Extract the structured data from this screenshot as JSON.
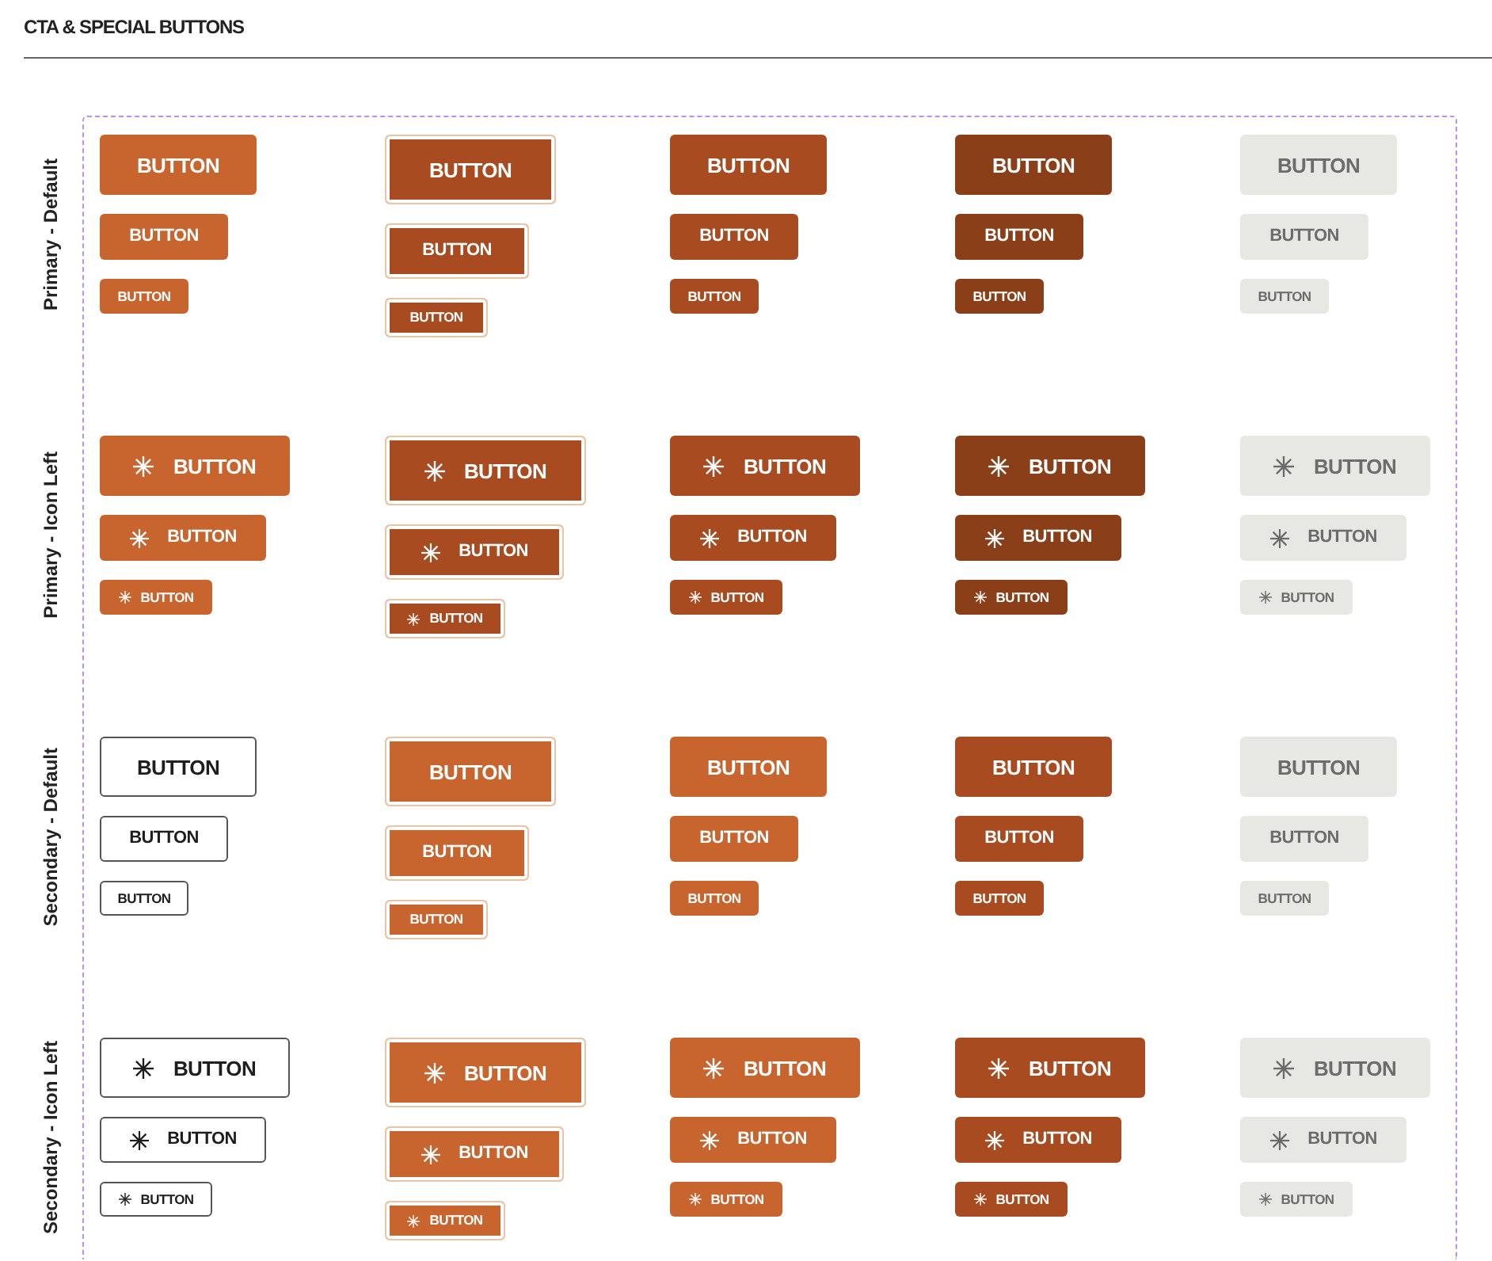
{
  "title": "CTA & SPECIAL BUTTONS",
  "groups": [
    {
      "label": "Primary - Default",
      "kind": "primary",
      "icon": false,
      "columns": [
        {
          "kind": "default",
          "buttons": [
            {
              "kind": "lg",
              "label": "BUTTON"
            },
            {
              "kind": "md",
              "label": "BUTTON"
            },
            {
              "kind": "sm",
              "label": "BUTTON"
            }
          ]
        },
        {
          "kind": "focus",
          "buttons": [
            {
              "kind": "lg",
              "label": "BUTTON"
            },
            {
              "kind": "md",
              "label": "BUTTON"
            },
            {
              "kind": "sm",
              "label": "BUTTON"
            }
          ]
        },
        {
          "kind": "hover",
          "buttons": [
            {
              "kind": "lg",
              "label": "BUTTON"
            },
            {
              "kind": "md",
              "label": "BUTTON"
            },
            {
              "kind": "sm",
              "label": "BUTTON"
            }
          ]
        },
        {
          "kind": "pressed",
          "buttons": [
            {
              "kind": "lg",
              "label": "BUTTON"
            },
            {
              "kind": "md",
              "label": "BUTTON"
            },
            {
              "kind": "sm",
              "label": "BUTTON"
            }
          ]
        },
        {
          "kind": "disabled",
          "buttons": [
            {
              "kind": "lg",
              "label": "BUTTON"
            },
            {
              "kind": "md",
              "label": "BUTTON"
            },
            {
              "kind": "sm",
              "label": "BUTTON"
            }
          ]
        }
      ]
    },
    {
      "label": "Primary - Icon Left",
      "kind": "primary",
      "icon": true,
      "columns": [
        {
          "kind": "default",
          "buttons": [
            {
              "kind": "lg",
              "label": "BUTTON"
            },
            {
              "kind": "md",
              "label": "BUTTON"
            },
            {
              "kind": "sm",
              "label": "BUTTON"
            }
          ]
        },
        {
          "kind": "focus",
          "buttons": [
            {
              "kind": "lg",
              "label": "BUTTON"
            },
            {
              "kind": "md",
              "label": "BUTTON"
            },
            {
              "kind": "sm",
              "label": "BUTTON"
            }
          ]
        },
        {
          "kind": "hover",
          "buttons": [
            {
              "kind": "lg",
              "label": "BUTTON"
            },
            {
              "kind": "md",
              "label": "BUTTON"
            },
            {
              "kind": "sm",
              "label": "BUTTON"
            }
          ]
        },
        {
          "kind": "pressed",
          "buttons": [
            {
              "kind": "lg",
              "label": "BUTTON"
            },
            {
              "kind": "md",
              "label": "BUTTON"
            },
            {
              "kind": "sm",
              "label": "BUTTON"
            }
          ]
        },
        {
          "kind": "disabled",
          "buttons": [
            {
              "kind": "lg",
              "label": "BUTTON"
            },
            {
              "kind": "md",
              "label": "BUTTON"
            },
            {
              "kind": "sm",
              "label": "BUTTON"
            }
          ]
        }
      ]
    },
    {
      "label": "Secondary - Default",
      "kind": "secondary",
      "icon": false,
      "columns": [
        {
          "kind": "default",
          "buttons": [
            {
              "kind": "lg",
              "label": "BUTTON"
            },
            {
              "kind": "md",
              "label": "BUTTON"
            },
            {
              "kind": "sm",
              "label": "BUTTON"
            }
          ]
        },
        {
          "kind": "focus",
          "buttons": [
            {
              "kind": "lg",
              "label": "BUTTON"
            },
            {
              "kind": "md",
              "label": "BUTTON"
            },
            {
              "kind": "sm",
              "label": "BUTTON"
            }
          ]
        },
        {
          "kind": "hover",
          "buttons": [
            {
              "kind": "lg",
              "label": "BUTTON"
            },
            {
              "kind": "md",
              "label": "BUTTON"
            },
            {
              "kind": "sm",
              "label": "BUTTON"
            }
          ]
        },
        {
          "kind": "pressed",
          "buttons": [
            {
              "kind": "lg",
              "label": "BUTTON"
            },
            {
              "kind": "md",
              "label": "BUTTON"
            },
            {
              "kind": "sm",
              "label": "BUTTON"
            }
          ]
        },
        {
          "kind": "disabled",
          "buttons": [
            {
              "kind": "lg",
              "label": "BUTTON"
            },
            {
              "kind": "md",
              "label": "BUTTON"
            },
            {
              "kind": "sm",
              "label": "BUTTON"
            }
          ]
        }
      ]
    },
    {
      "label": "Secondary - Icon Left",
      "kind": "secondary",
      "icon": true,
      "columns": [
        {
          "kind": "default",
          "buttons": [
            {
              "kind": "lg",
              "label": "BUTTON"
            },
            {
              "kind": "md",
              "label": "BUTTON"
            },
            {
              "kind": "sm",
              "label": "BUTTON"
            }
          ]
        },
        {
          "kind": "focus",
          "buttons": [
            {
              "kind": "lg",
              "label": "BUTTON"
            },
            {
              "kind": "md",
              "label": "BUTTON"
            },
            {
              "kind": "sm",
              "label": "BUTTON"
            }
          ]
        },
        {
          "kind": "hover",
          "buttons": [
            {
              "kind": "lg",
              "label": "BUTTON"
            },
            {
              "kind": "md",
              "label": "BUTTON"
            },
            {
              "kind": "sm",
              "label": "BUTTON"
            }
          ]
        },
        {
          "kind": "pressed",
          "buttons": [
            {
              "kind": "lg",
              "label": "BUTTON"
            },
            {
              "kind": "md",
              "label": "BUTTON"
            },
            {
              "kind": "sm",
              "label": "BUTTON"
            }
          ]
        },
        {
          "kind": "disabled",
          "buttons": [
            {
              "kind": "lg",
              "label": "BUTTON"
            },
            {
              "kind": "md",
              "label": "BUTTON"
            },
            {
              "kind": "sm",
              "label": "BUTTON"
            }
          ]
        }
      ]
    }
  ]
}
